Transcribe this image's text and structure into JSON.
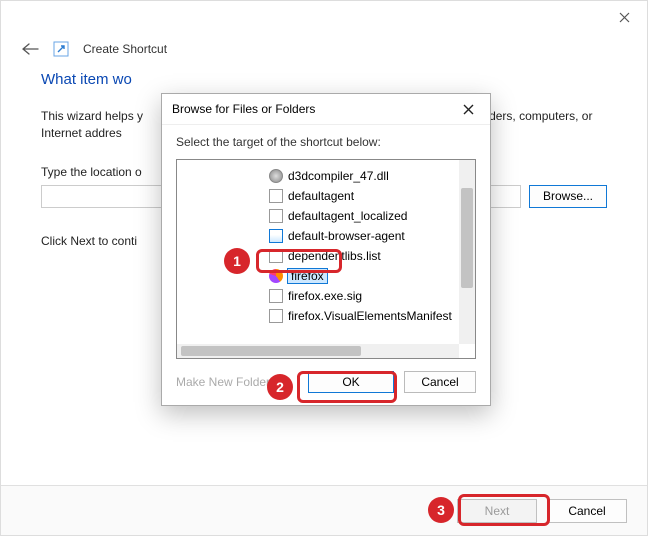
{
  "window": {
    "title": "Create Shortcut",
    "heading_truncated": "What item wo",
    "intro_before": "This wizard helps y",
    "intro_after": "olders, computers, or Internet addres",
    "location_label_truncated": "Type the location o",
    "continue_text": "Click Next to conti",
    "browse_btn": "Browse...",
    "next_btn": "Next",
    "cancel_btn": "Cancel"
  },
  "modal": {
    "title": "Browse for Files or Folders",
    "instruction": "Select the target of the shortcut below:",
    "make_folder": "Make New Folder",
    "ok": "OK",
    "cancel": "Cancel",
    "items": [
      {
        "label": "d3dcompiler_47.dll",
        "icon": "gear",
        "selected": false
      },
      {
        "label": "defaultagent",
        "icon": "file",
        "selected": false
      },
      {
        "label": "defaultagent_localized",
        "icon": "file",
        "selected": false
      },
      {
        "label": "default-browser-agent",
        "icon": "app",
        "selected": false
      },
      {
        "label": "dependentlibs.list",
        "icon": "file",
        "selected": false
      },
      {
        "label": "firefox",
        "icon": "fx",
        "selected": true
      },
      {
        "label": "firefox.exe.sig",
        "icon": "file",
        "selected": false
      },
      {
        "label": "firefox.VisualElementsManifest",
        "icon": "file",
        "selected": false
      }
    ]
  },
  "callouts": {
    "b1": "1",
    "b2": "2",
    "b3": "3"
  }
}
